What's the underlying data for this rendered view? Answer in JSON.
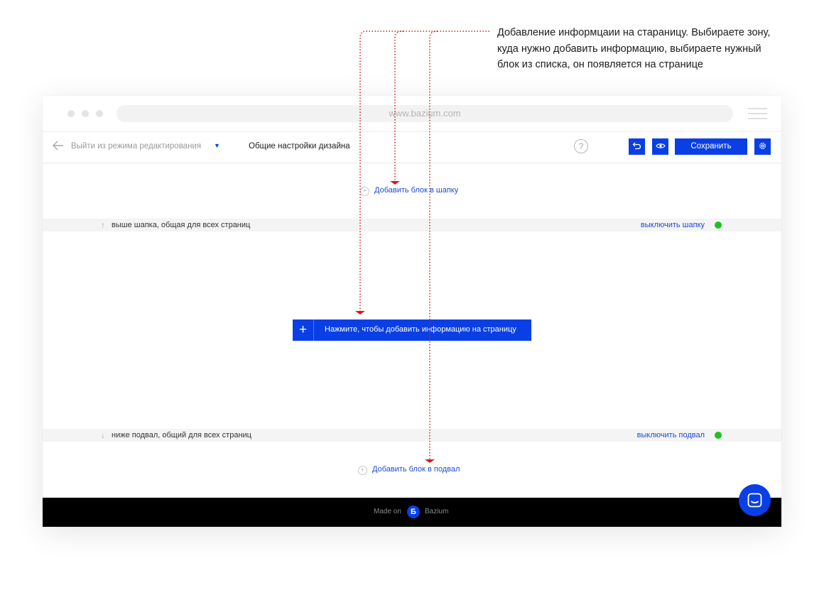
{
  "annotation": {
    "lines": [
      "Добавление информцаии на стараницу. Выбираете зону,",
      "куда нужно добавить информацию, выбираете нужный",
      "блок из списка, он появляется на странице"
    ]
  },
  "browser": {
    "url": "www.bazium.com"
  },
  "toolbar": {
    "exit_label": "Выйти из режима редактирования",
    "design_settings": "Общие настройки дизайна",
    "help_symbol": "?",
    "save_label": "Сохранить"
  },
  "header_zone": {
    "add_block_label": "Добавить блок в шапку",
    "band_text": "выше шапка, общая для всех страниц",
    "toggle_link": "выключить шапку",
    "status_color": "#1fc11f"
  },
  "content_zone": {
    "add_info_plus": "+",
    "add_info_label": "Нажмите, чтобы добавить информацию на страницу"
  },
  "footer_zone": {
    "band_text": "ниже подвал, общий для всех страниц",
    "toggle_link": "выключить подвал",
    "add_block_label": "Добавить блок в подвал",
    "status_color": "#1fc11f"
  },
  "site_footer": {
    "made_on": "Made on",
    "logo_letter": "Б",
    "brand": "Bazium"
  },
  "colors": {
    "accent": "#0a3fe6",
    "annotation_line": "#d61a1a",
    "link": "#1e4bd8",
    "footer_bg": "#000000"
  },
  "icons": [
    "back-arrow-icon",
    "dropdown-caret-icon",
    "help-icon",
    "undo-icon",
    "eye-icon",
    "gear-icon",
    "plus-circle-icon",
    "arrow-up-icon",
    "arrow-down-icon",
    "chat-icon",
    "bazium-logo-icon"
  ]
}
